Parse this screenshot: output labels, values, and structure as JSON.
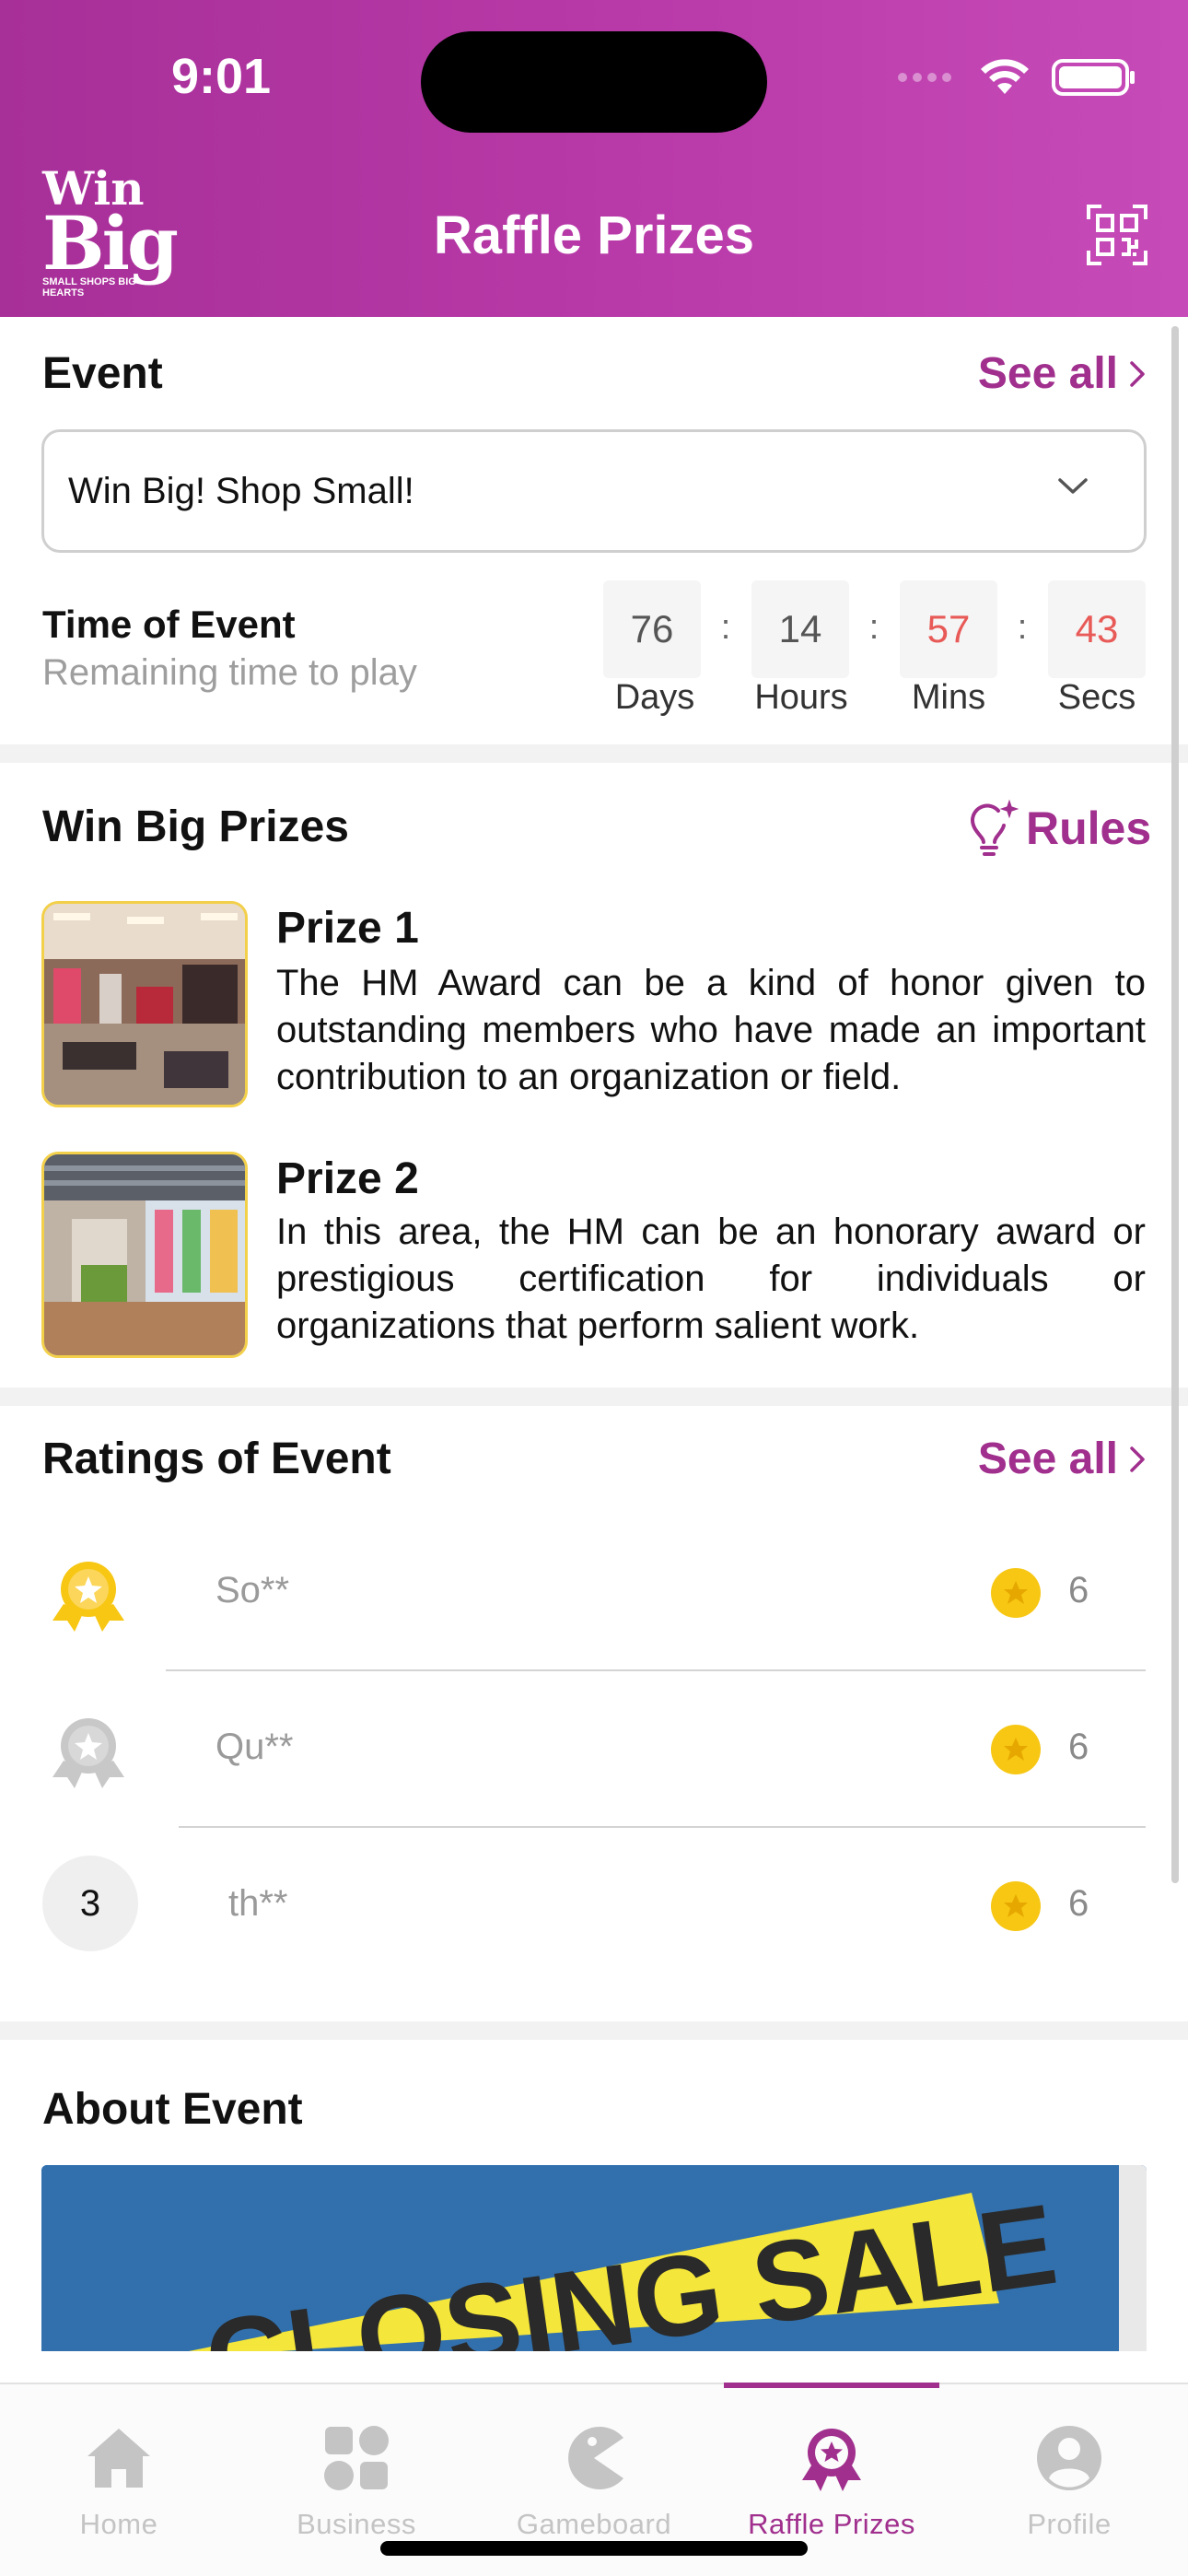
{
  "status_bar": {
    "time": "9:01"
  },
  "header": {
    "logo_line1": "Win",
    "logo_line2": "Big",
    "logo_tagline": "SMALL SHOPS BIG HEARTS",
    "title": "Raffle Prizes",
    "qr_icon": "qr-code-icon"
  },
  "event_section": {
    "title": "Event",
    "see_all": "See all",
    "selected_event": "Win Big! Shop Small!",
    "time_label": "Time of Event",
    "time_sub": "Remaining time to play",
    "countdown": [
      {
        "value": "76",
        "label": "Days",
        "highlight": false
      },
      {
        "value": "14",
        "label": "Hours",
        "highlight": false
      },
      {
        "value": "57",
        "label": "Mins",
        "highlight": true
      },
      {
        "value": "43",
        "label": "Secs",
        "highlight": true
      }
    ],
    "separator": ":"
  },
  "prizes_section": {
    "title": "Win Big Prizes",
    "rules_label": "Rules",
    "rules_icon": "lightbulb-sparkle-icon",
    "items": [
      {
        "title": "Prize 1",
        "description": "The HM Award can be a kind of honor given to outstanding members who have made an important contribution to an organization or field."
      },
      {
        "title": "Prize 2",
        "description": "In this area, the HM can be an honorary award or prestigious certification for individuals or organizations that perform salient work."
      }
    ]
  },
  "ratings_section": {
    "title": "Ratings of Event",
    "see_all": "See all",
    "rows": [
      {
        "rank": "1",
        "name": "So**",
        "score": "6"
      },
      {
        "rank": "2",
        "name": "Qu**",
        "score": "6"
      },
      {
        "rank": "3",
        "name": "th**",
        "score": "6"
      }
    ]
  },
  "about_section": {
    "title": "About Event",
    "banner_text": "CLOSING SALE"
  },
  "tabbar": {
    "tabs": [
      {
        "label": "Home",
        "icon": "home-icon",
        "active": false
      },
      {
        "label": "Business",
        "icon": "grid-icon",
        "active": false
      },
      {
        "label": "Gameboard",
        "icon": "pacman-icon",
        "active": false
      },
      {
        "label": "Raffle Prizes",
        "icon": "award-icon",
        "active": true
      },
      {
        "label": "Profile",
        "icon": "profile-icon",
        "active": false
      }
    ]
  },
  "colors": {
    "brand": "#a02f8d",
    "header_start": "#a72f98",
    "header_end": "#c64bb8",
    "countdown_red": "#e85a57",
    "gold": "#f7c713",
    "silver": "#c8c8c8"
  }
}
